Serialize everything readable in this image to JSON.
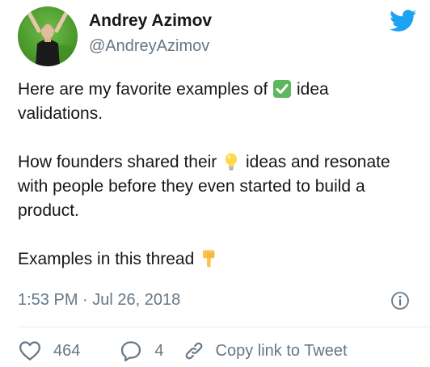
{
  "author": {
    "name": "Andrey Azimov",
    "handle": "@AndreyAzimov"
  },
  "tweet": {
    "line1_pre": "Here are my favorite examples of",
    "line1_emoji": "check-mark-button-emoji",
    "line1_post": "idea validations.",
    "para2_pre": "How founders shared their",
    "para2_emoji": "light-bulb-emoji",
    "para2_post": "ideas and resonate with people before they even started to build a product.",
    "para3_text": "Examples in this thread",
    "para3_emoji": "backhand-index-pointing-down-emoji",
    "timestamp": "1:53 PM · Jul 26, 2018"
  },
  "actions": {
    "likes": "464",
    "replies": "4",
    "copy_link": "Copy link to Tweet"
  },
  "colors": {
    "text": "#14171a",
    "secondary": "#657786",
    "twitter_blue": "#1da1f2",
    "divider": "#e6ecf0"
  },
  "icons": [
    "twitter-bird-icon",
    "info-icon",
    "heart-icon",
    "reply-icon",
    "link-icon"
  ]
}
